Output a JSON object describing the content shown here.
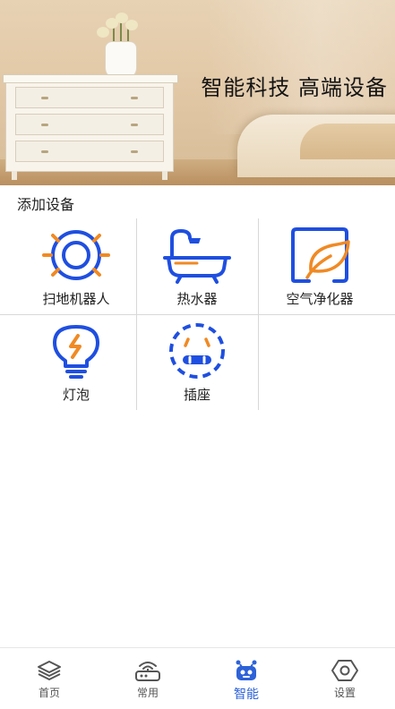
{
  "banner": {
    "slogan": "智能科技  高端设备",
    "illustration": "bedroom-photo"
  },
  "section": {
    "title": "添加设备"
  },
  "devices": [
    {
      "label": "扫地机器人",
      "icon": "robot-vacuum-icon"
    },
    {
      "label": "热水器",
      "icon": "bathtub-icon"
    },
    {
      "label": "空气净化器",
      "icon": "leaf-icon"
    },
    {
      "label": "灯泡",
      "icon": "lightbulb-icon"
    },
    {
      "label": "插座",
      "icon": "power-socket-icon"
    }
  ],
  "tabbar": {
    "items": [
      {
        "label": "首页",
        "icon": "layers-icon",
        "active": false
      },
      {
        "label": "常用",
        "icon": "router-icon",
        "active": false
      },
      {
        "label": "智能",
        "icon": "robot-icon",
        "active": true
      },
      {
        "label": "设置",
        "icon": "hexagon-settings-icon",
        "active": false
      }
    ]
  },
  "colors": {
    "accent": "#2d62d8",
    "icon_blue": "#1f4fe0",
    "icon_warm": "#f08a24",
    "divider": "#d8d8d8"
  }
}
